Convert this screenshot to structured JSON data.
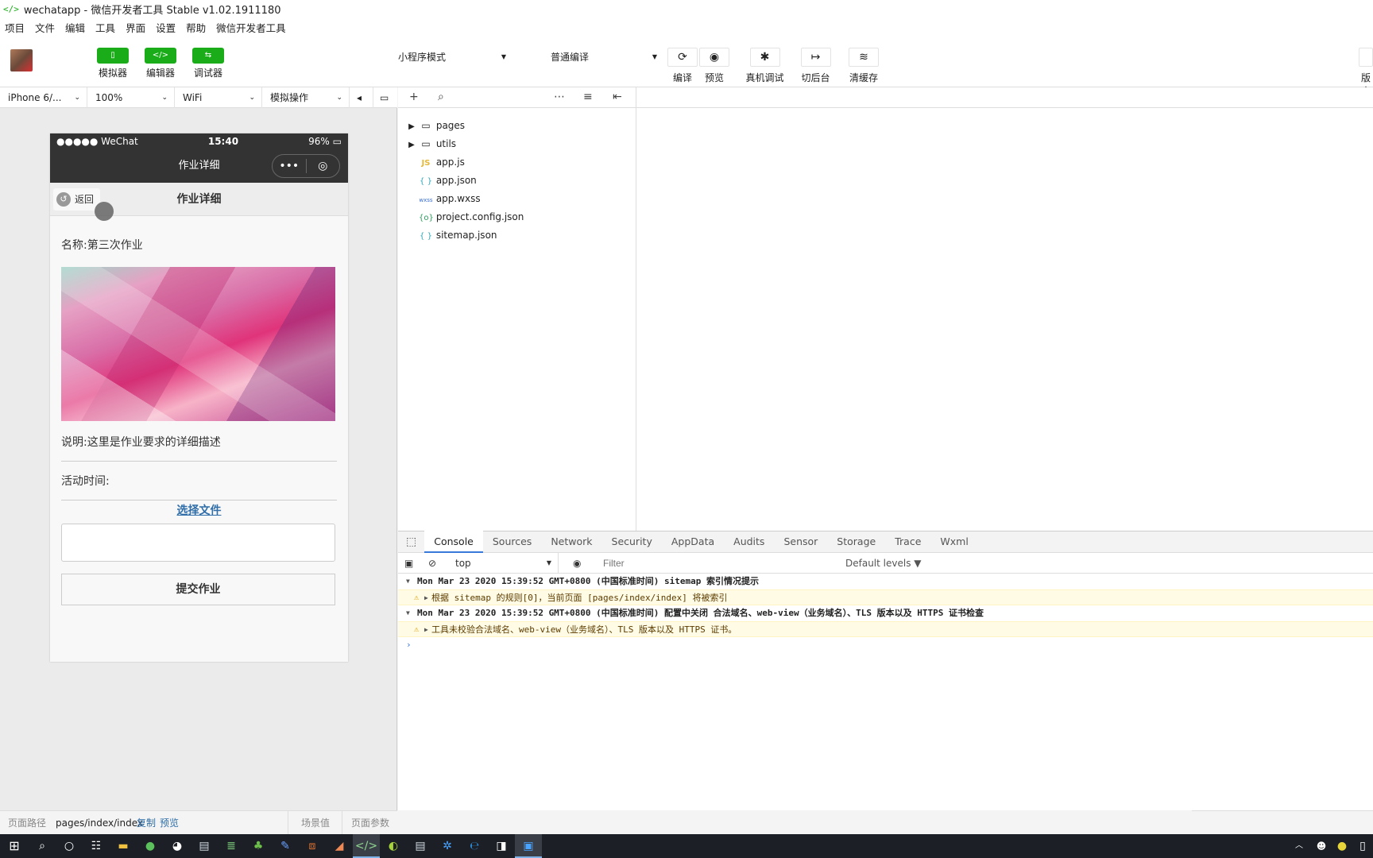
{
  "window": {
    "title": "wechatapp - 微信开发者工具 Stable v1.02.1911180",
    "app_icon": "code-icon"
  },
  "menu": [
    "项目",
    "文件",
    "编辑",
    "工具",
    "界面",
    "设置",
    "帮助",
    "微信开发者工具"
  ],
  "toolbar": {
    "simulator_label": "模拟器",
    "editor_label": "编辑器",
    "debugger_label": "调试器",
    "mode_select": "小程序模式",
    "compile_select": "普通编译",
    "compile_label": "编译",
    "preview_label": "预览",
    "remote_debug_label": "真机调试",
    "background_label": "切后台",
    "clear_cache_label": "清缓存",
    "version_label": "版本",
    "accent_color": "#1aad19"
  },
  "simbar": {
    "device": "iPhone 6/...",
    "zoom": "100%",
    "network": "WiFi",
    "simulate": "模拟操作"
  },
  "phone": {
    "status": {
      "carrier": "●●●●● WeChat",
      "time": "15:40",
      "battery": "96%"
    },
    "nav_title": "作业详细",
    "sub_title": "作业详细",
    "back_label": "返回",
    "name_row": "名称:第三次作业",
    "desc_row": "说明:这里是作业要求的详细描述",
    "time_row": "活动时间:",
    "choose_file": "选择文件",
    "submit_label": "提交作业"
  },
  "pathbar": {
    "label": "页面路径",
    "path": "pages/index/index",
    "copy": "复制",
    "preview": "预览",
    "scene": "场景值",
    "params": "页面参数"
  },
  "files": [
    {
      "name": "pages",
      "type": "folder"
    },
    {
      "name": "utils",
      "type": "folder"
    },
    {
      "name": "app.js",
      "type": "js"
    },
    {
      "name": "app.json",
      "type": "json"
    },
    {
      "name": "app.wxss",
      "type": "wxss"
    },
    {
      "name": "project.config.json",
      "type": "config"
    },
    {
      "name": "sitemap.json",
      "type": "json"
    }
  ],
  "devtools": {
    "tabs": [
      "Console",
      "Sources",
      "Network",
      "Security",
      "AppData",
      "Audits",
      "Sensor",
      "Storage",
      "Trace",
      "Wxml"
    ],
    "active_tab": "Console",
    "context": "top",
    "filter_placeholder": "Filter",
    "levels": "Default levels ▼"
  },
  "console": {
    "group1": "Mon Mar 23 2020 15:39:52 GMT+0800 (中国标准时间) sitemap 索引情况提示",
    "warn1": "根据 sitemap 的规则[0]，当前页面 [pages/index/index] 将被索引",
    "group2": "Mon Mar 23 2020 15:39:52 GMT+0800 (中国标准时间) 配置中关闭 合法域名、web-view（业务域名）、TLS 版本以及 HTTPS 证书检查",
    "warn2": "工具未校验合法域名、web-view（业务域名）、TLS 版本以及 HTTPS 证书。"
  },
  "taskbar": [
    "windows-icon",
    "search-icon",
    "cortana-icon",
    "task-view-icon",
    "folder-icon",
    "app-icon",
    "app-icon",
    "notes-icon",
    "app-icon",
    "app-icon",
    "pen-icon",
    "app-icon",
    "app-icon",
    "wechat-devtools-icon",
    "app-icon",
    "notes-icon",
    "app-icon",
    "edge-icon",
    "app-icon",
    "app-icon"
  ]
}
